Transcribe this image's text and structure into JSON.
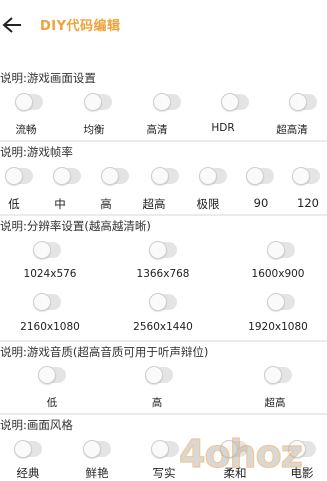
{
  "header": {
    "title": "DIY代码编辑",
    "back_icon": "back-arrow-icon"
  },
  "sections": [
    {
      "label": "说明:游戏画面设置",
      "options": [
        "流畅",
        "均衡",
        "高清",
        "HDR",
        "超高清"
      ]
    },
    {
      "label": "说明:游戏帧率",
      "options": [
        "低",
        "中",
        "高",
        "超高",
        "极限",
        "90",
        "120"
      ]
    },
    {
      "label": "说明:分辨率设置(越高越清晰)",
      "options": [
        "1024x576",
        "1366x768",
        "1600x900",
        "2160x1080",
        "2560x1440",
        "1920x1080"
      ]
    },
    {
      "label": "说明:游戏音质(超高音质可用于听声辩位)",
      "options": [
        "低",
        "高",
        "超高"
      ]
    },
    {
      "label": "说明:画面风格",
      "options": [
        "经典",
        "鲜艳",
        "写实",
        "柔和",
        "电影"
      ]
    }
  ],
  "watermark": {
    "text": "4ohoz",
    "colors": [
      "#e89a3c",
      "#b9b9b9"
    ]
  },
  "colors": {
    "title": "#f0a23a",
    "toggle_track": "#e4e4e4",
    "toggle_knob": "#fafafa"
  }
}
